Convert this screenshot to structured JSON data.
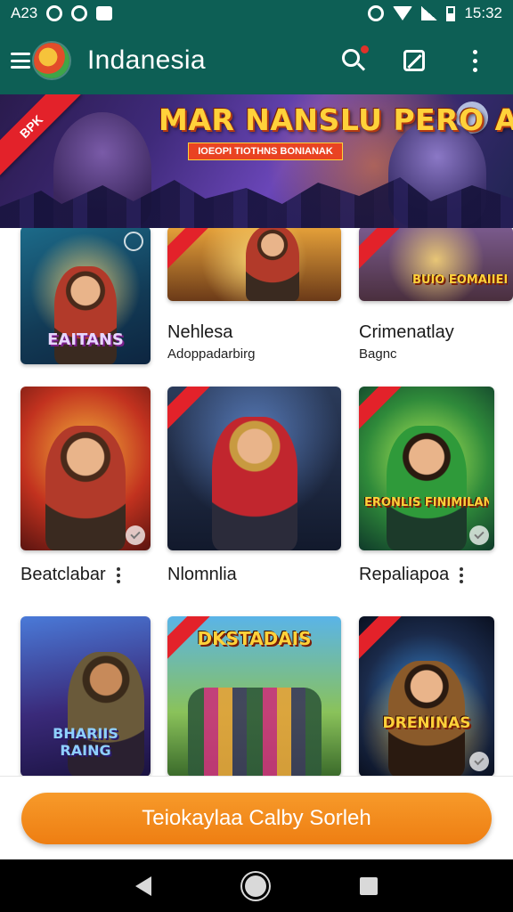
{
  "status_bar": {
    "left_text": "A23",
    "time": "15:32"
  },
  "app_bar": {
    "title": "Indanesia"
  },
  "banner": {
    "ribbon": "BPK",
    "headline": "MAR NANSLU PERO AILAS",
    "subline": "IOEOPI TIOTHNS BONIANAK"
  },
  "games": [
    {
      "art_text": "EAITANS",
      "title": "",
      "subtitle": ""
    },
    {
      "art_text": "",
      "title": "Nehlesa",
      "subtitle": "Adoppadarbirg"
    },
    {
      "art_text": "BUIO EOMAIIEI",
      "title": "Crimenatlay",
      "subtitle": "Bagnc"
    },
    {
      "art_text": "",
      "title": "Beatclabar",
      "subtitle": ""
    },
    {
      "art_text": "",
      "title": "Nlomnlia",
      "subtitle": ""
    },
    {
      "art_text": "ERONLIS FINIMILAN",
      "title": "Repaliapoa",
      "subtitle": ""
    },
    {
      "art_text": "BHARIIS RAING",
      "title": "",
      "subtitle": ""
    },
    {
      "art_text": "DKSTADAIS",
      "title": "",
      "subtitle": ""
    },
    {
      "art_text": "DRENINAS",
      "title": "",
      "subtitle": ""
    }
  ],
  "cta": {
    "label": "Teiokaylaa Calby Sorleh"
  },
  "colors": {
    "app_bar": "#0d5f55",
    "accent": "#ee7e12",
    "nav_bar": "#000000"
  },
  "icons": [
    "menu-icon",
    "app-logo-icon",
    "search-icon",
    "edit-icon",
    "more-vert-icon",
    "back-icon",
    "home-icon",
    "recents-icon"
  ]
}
